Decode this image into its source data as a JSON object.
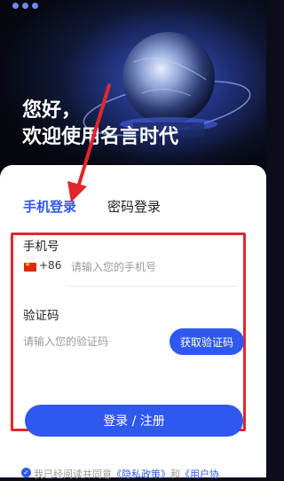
{
  "hero": {
    "title_line1": "您好，",
    "title_line2": "欢迎使用名言时代"
  },
  "tabs": [
    {
      "label": "手机登录",
      "active": true
    },
    {
      "label": "密码登录",
      "active": false
    }
  ],
  "phone": {
    "label": "手机号",
    "country_flag": "china-flag-icon",
    "country_code": "+86",
    "placeholder": "请输入您的手机号",
    "value": ""
  },
  "code": {
    "label": "验证码",
    "placeholder": "请输入您的验证码",
    "value": "",
    "get_code_label": "获取验证码"
  },
  "login_button": "登录 / 注册",
  "agreement": {
    "prefix": "我已经阅读并同意",
    "privacy_link": "《隐私政策》",
    "and": "和",
    "user_link": "《用户协"
  },
  "colors": {
    "accent": "#2f59ee",
    "highlight": "#e2262c",
    "hero_bg": "#070912"
  }
}
